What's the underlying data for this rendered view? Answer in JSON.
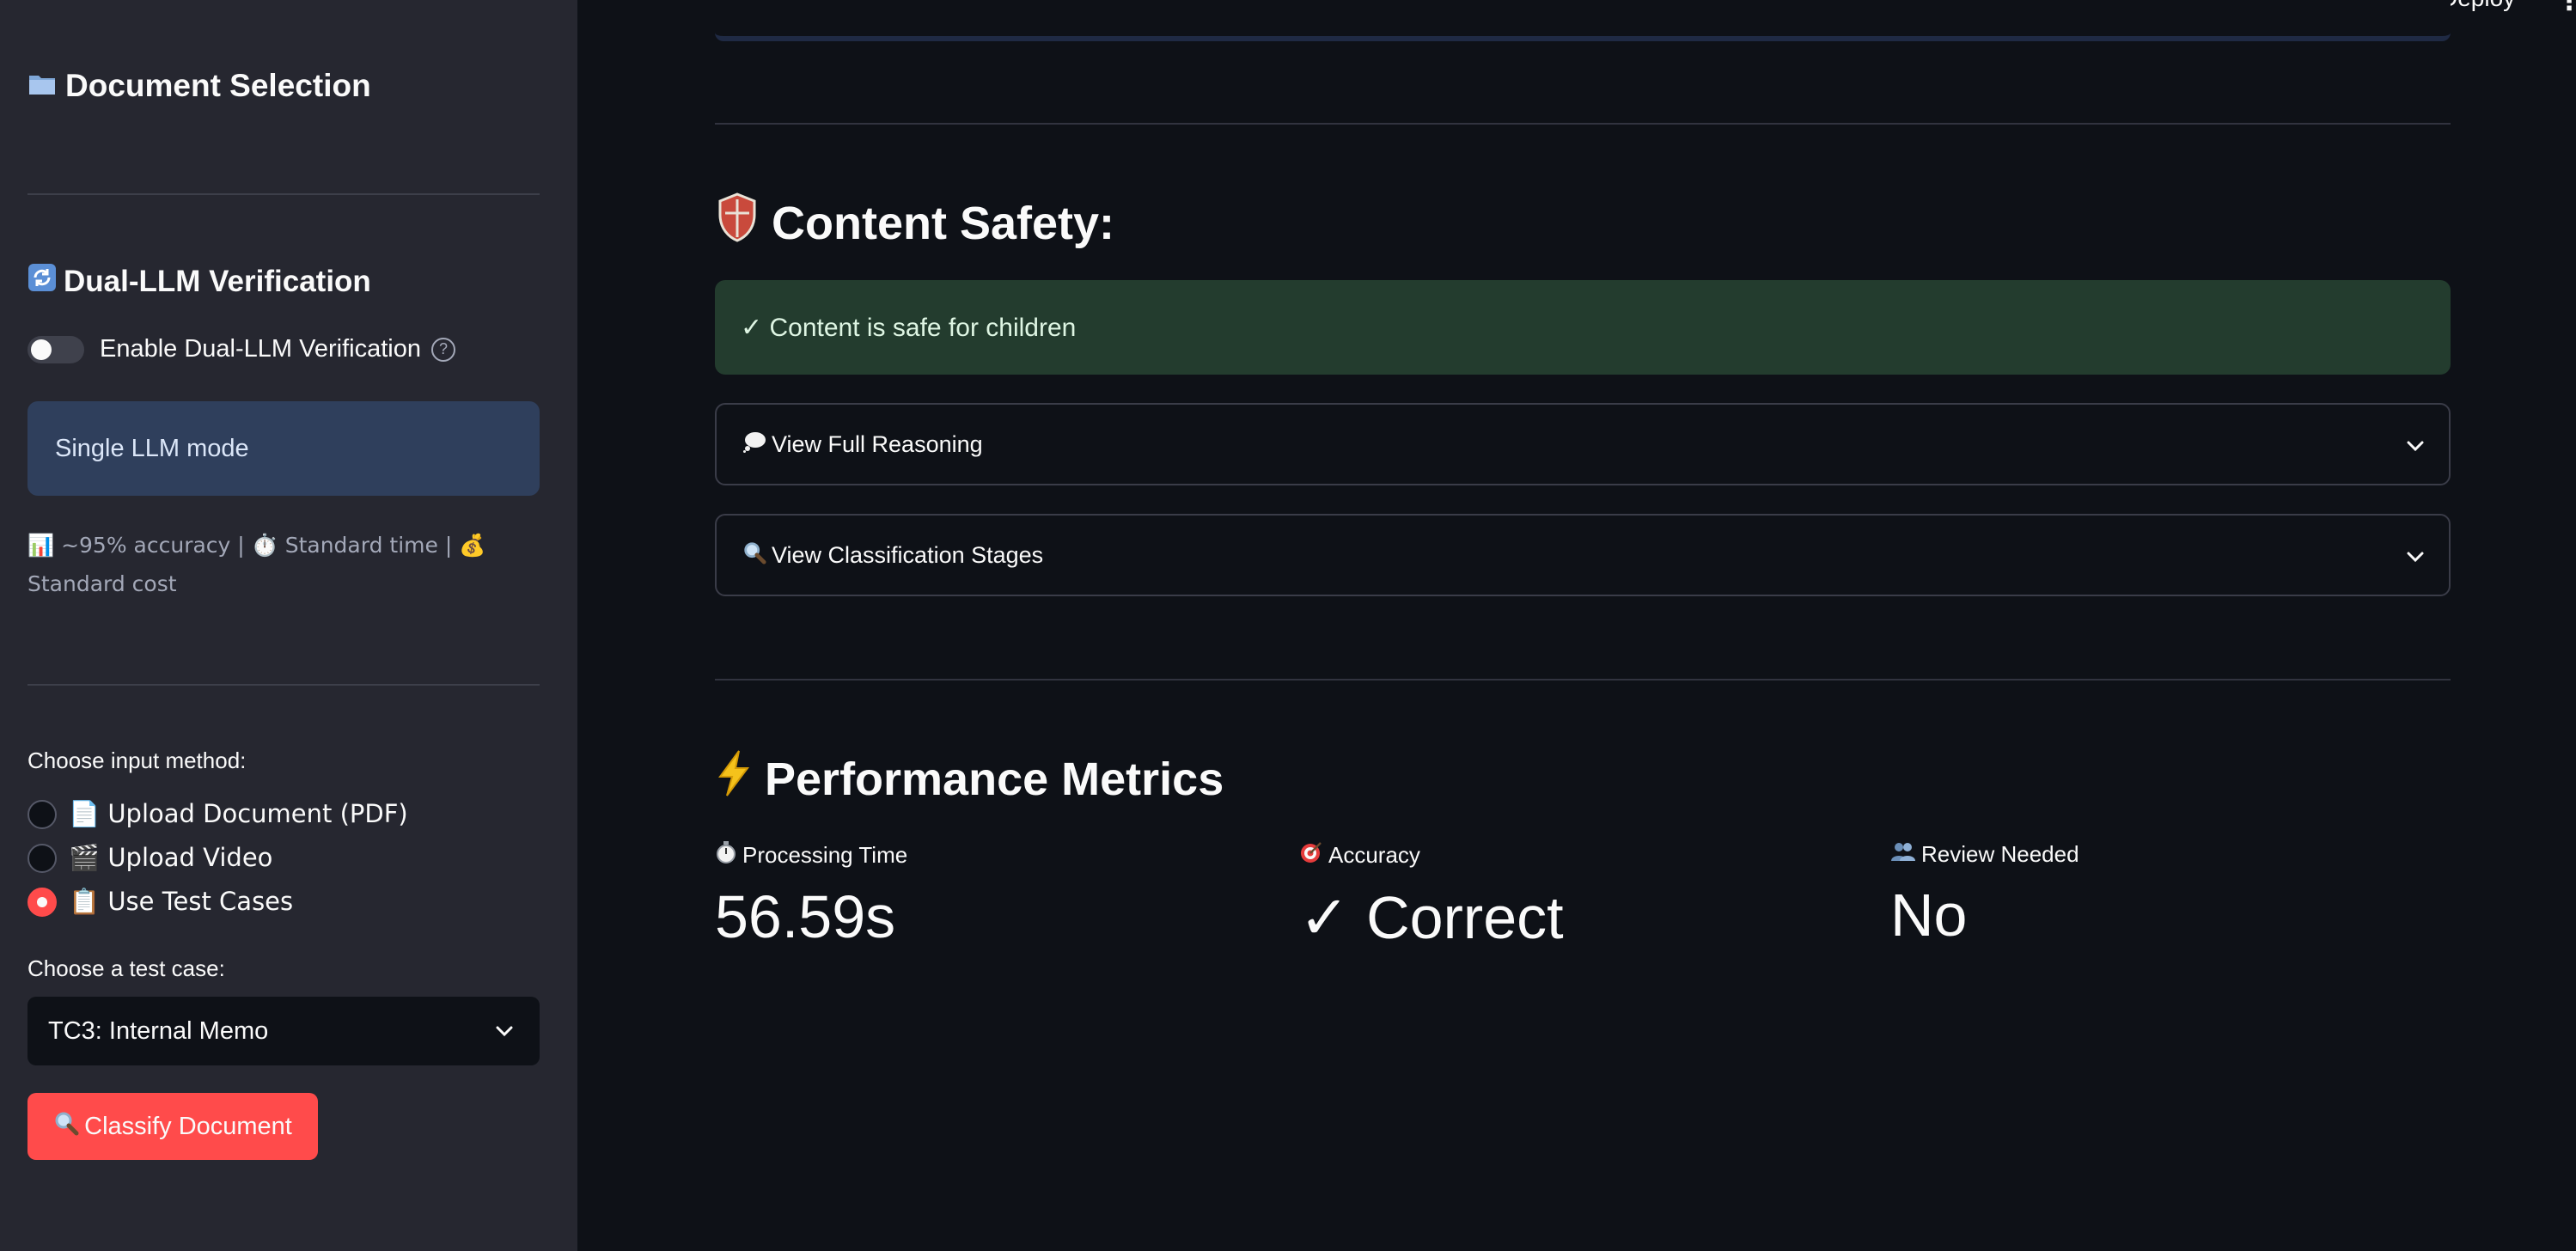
{
  "header": {
    "deploy_label": "Deploy",
    "menu_glyph": "⋮"
  },
  "sidebar": {
    "title": "Document Selection",
    "title_icon": "folder-icon",
    "verification_heading": "Dual-LLM Verification",
    "verification_icon": "cycle-arrows-icon",
    "toggle_label": "Enable Dual-LLM Verification",
    "toggle_on": false,
    "help_glyph": "?",
    "mode_info": "Single LLM mode",
    "caption": "📊 ~95% accuracy | ⏱️ Standard time | 💰 Standard cost",
    "input_method_label": "Choose input method:",
    "input_methods": [
      {
        "label": "📄 Upload Document (PDF)",
        "selected": false
      },
      {
        "label": "🎬 Upload Video",
        "selected": false
      },
      {
        "label": "📋 Use Test Cases",
        "selected": true
      }
    ],
    "test_case_label": "Choose a test case:",
    "test_case_selected": "TC3: Internal Memo",
    "classify_button": "Classify Document",
    "classify_icon": "magnifier-icon"
  },
  "main": {
    "safety_heading": "Content Safety:",
    "safety_icon": "shield-icon",
    "safety_result": "✓ Content is safe for children",
    "expanders": [
      {
        "label": "View Full Reasoning",
        "icon": "thought-bubble-icon"
      },
      {
        "label": "View Classification Stages",
        "icon": "magnifier-icon"
      }
    ],
    "metrics_heading": "Performance Metrics",
    "metrics_icon": "lightning-icon",
    "metrics": [
      {
        "label": "Processing Time",
        "icon": "stopwatch-icon",
        "value": "56.59s"
      },
      {
        "label": "Accuracy",
        "icon": "target-icon",
        "value": "✓ Correct"
      },
      {
        "label": "Review Needed",
        "icon": "people-icon",
        "value": "No"
      }
    ]
  },
  "colors": {
    "app_bg": "#0e1117",
    "sidebar_bg": "#262730",
    "primary": "#ff4b4b",
    "info_bg": "#2f3f5c",
    "success_bg": "#233c2e"
  }
}
